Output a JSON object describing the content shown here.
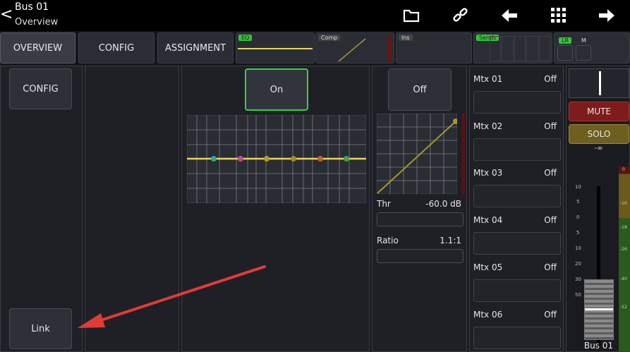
{
  "header": {
    "back_icon": "chevron-left-icon",
    "title": "Bus 01",
    "subtitle": "Overview",
    "icons": [
      "folder-icon",
      "link-icon",
      "arrow-left-icon",
      "grid-icon",
      "arrow-right-icon"
    ]
  },
  "tabs": {
    "overview": "OVERVIEW",
    "config": "CONFIG",
    "assignment": "ASSIGNMENT",
    "eq_label": "EQ",
    "comp_label": "Comp",
    "ins_label": "Ins",
    "sends_label": "Sends",
    "lr_label": "LR",
    "m_label": "M"
  },
  "left": {
    "config_button": "CONFIG",
    "link_button": "Link"
  },
  "eq": {
    "on_button": "On"
  },
  "comp": {
    "off_button": "Off",
    "thr_label": "Thr",
    "thr_value": "-60.0 dB",
    "ratio_label": "Ratio",
    "ratio_value": "1.1:1"
  },
  "matrix": [
    {
      "name": "Mtx 01",
      "state": "Off"
    },
    {
      "name": "Mtx 02",
      "state": "Off"
    },
    {
      "name": "Mtx 03",
      "state": "Off"
    },
    {
      "name": "Mtx 04",
      "state": "Off"
    },
    {
      "name": "Mtx 05",
      "state": "Off"
    },
    {
      "name": "Mtx 06",
      "state": "Off"
    }
  ],
  "channel": {
    "mute": "MUTE",
    "solo": "SOLO",
    "level": "-∞",
    "name": "Bus 01",
    "fader_scale": [
      "10",
      "5",
      "0",
      "5",
      "10",
      "20",
      "30",
      "50"
    ],
    "meter_scale": [
      "0",
      "-10",
      "-18",
      "-26",
      "-40",
      "-52"
    ]
  },
  "colors": {
    "accent_green": "#36c33b",
    "eq_line": "#e7d55a",
    "mute_red": "#8b1e1e",
    "solo_yellow": "#7a6a25",
    "arrow_red": "#e23b36"
  }
}
